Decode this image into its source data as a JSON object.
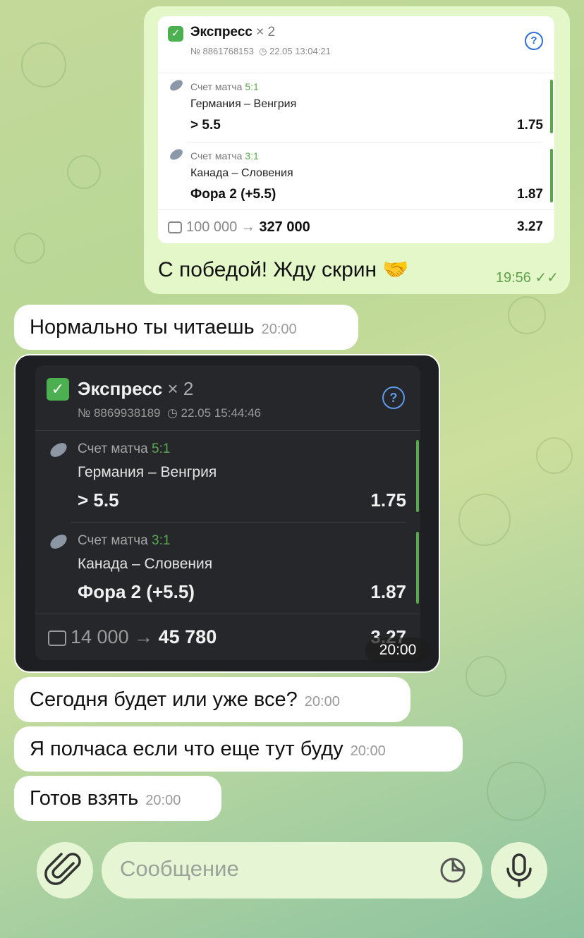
{
  "bet1": {
    "title": "Экспресс",
    "mult": "× 2",
    "number": "№ 8861768153",
    "datetime": "22.05 13:04:21",
    "legs": [
      {
        "label": "Счет матча",
        "score": "5:1",
        "teams": "Германия – Венгрия",
        "pick": "> 5.5",
        "odd": "1.75"
      },
      {
        "label": "Счет матча",
        "score": "3:1",
        "teams": "Канада – Словения",
        "pick": "Фора 2 (+5.5)",
        "odd": "1.87"
      }
    ],
    "stake_from": "100 000",
    "arrow": "→",
    "stake_to": "327 000",
    "total_odd": "3.27"
  },
  "out_msg": {
    "text": "С победой! Жду скрин 🤝",
    "time": "19:56"
  },
  "in_msg1": {
    "text": "Нормально ты читаешь",
    "time": "20:00"
  },
  "bet2": {
    "title": "Экспресс",
    "mult": "× 2",
    "number": "№ 8869938189",
    "datetime": "22.05 15:44:46",
    "legs": [
      {
        "label": "Счет матча",
        "score": "5:1",
        "teams": "Германия – Венгрия",
        "pick": "> 5.5",
        "odd": "1.75"
      },
      {
        "label": "Счет матча",
        "score": "3:1",
        "teams": "Канада – Словения",
        "pick": "Фора 2 (+5.5)",
        "odd": "1.87"
      }
    ],
    "stake_from": "14 000",
    "arrow": "→",
    "stake_to": "45 780",
    "total_odd": "3.27",
    "time": "20:00"
  },
  "in_msg2": {
    "text": "Сегодня будет или уже все?",
    "time": "20:00"
  },
  "in_msg3": {
    "text": "Я полчаса если что еще тут буду",
    "time": "20:00"
  },
  "in_msg4": {
    "text": "Готов взять",
    "time": "20:00"
  },
  "composer": {
    "placeholder": "Сообщение"
  },
  "colors": {
    "accent_green": "#4caf50",
    "score_green": "#5aa84e",
    "outgoing_bubble": "#e3f7c9",
    "time_green": "#5fa04a"
  }
}
